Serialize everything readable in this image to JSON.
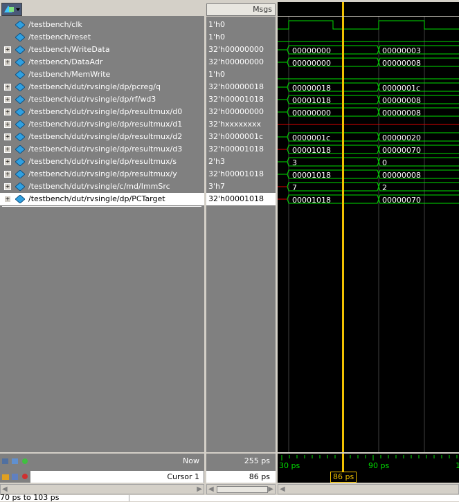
{
  "header": {
    "msgs_label": "Msgs"
  },
  "signals": [
    {
      "name": "/testbench/clk",
      "value": "1'h0",
      "expand": false
    },
    {
      "name": "/testbench/reset",
      "value": "1'h0",
      "expand": false
    },
    {
      "name": "/testbench/WriteData",
      "value": "32'h00000000",
      "expand": true
    },
    {
      "name": "/testbench/DataAdr",
      "value": "32'h00000000",
      "expand": true
    },
    {
      "name": "/testbench/MemWrite",
      "value": "1'h0",
      "expand": false
    },
    {
      "name": "/testbench/dut/rvsingle/dp/pcreg/q",
      "value": "32'h00000018",
      "expand": true
    },
    {
      "name": "/testbench/dut/rvsingle/dp/rf/wd3",
      "value": "32'h00001018",
      "expand": true
    },
    {
      "name": "/testbench/dut/rvsingle/dp/resultmux/d0",
      "value": "32'h00000000",
      "expand": true
    },
    {
      "name": "/testbench/dut/rvsingle/dp/resultmux/d1",
      "value": "32'hxxxxxxxx",
      "expand": true
    },
    {
      "name": "/testbench/dut/rvsingle/dp/resultmux/d2",
      "value": "32'h0000001c",
      "expand": true
    },
    {
      "name": "/testbench/dut/rvsingle/dp/resultmux/d3",
      "value": "32'h00001018",
      "expand": true
    },
    {
      "name": "/testbench/dut/rvsingle/dp/resultmux/s",
      "value": "2'h3",
      "expand": true
    },
    {
      "name": "/testbench/dut/rvsingle/dp/resultmux/y",
      "value": "32'h00001018",
      "expand": true
    },
    {
      "name": "/testbench/dut/rvsingle/c/md/ImmSrc",
      "value": "3'h7",
      "expand": true
    },
    {
      "name": "/testbench/dut/rvsingle/dp/PCTarget",
      "value": "32'h00001018",
      "expand": true
    }
  ],
  "wave_labels": [
    {
      "a": "",
      "b": ""
    },
    {
      "a": "",
      "b": ""
    },
    {
      "a": "00000000",
      "b": "00000003"
    },
    {
      "a": "00000000",
      "b": "00000008"
    },
    {
      "a": "",
      "b": ""
    },
    {
      "a": "00000018",
      "b": "0000001c"
    },
    {
      "a": "00001018",
      "b": "00000008"
    },
    {
      "a": "00000000",
      "b": "00000008"
    },
    {
      "a": "",
      "b": ""
    },
    {
      "a": "0000001c",
      "b": "00000020"
    },
    {
      "a": "00001018",
      "b": "00000070"
    },
    {
      "a": "3",
      "b": "0"
    },
    {
      "a": "00001018",
      "b": "00000008"
    },
    {
      "a": "7",
      "b": "2"
    },
    {
      "a": "00001018",
      "b": "00000070"
    }
  ],
  "footer": {
    "now_label": "Now",
    "now_value": "255 ps",
    "cursor_label": "Cursor 1",
    "cursor_value": "86 ps",
    "time_tick_1": "30 ps",
    "time_tick_2": "90 ps",
    "time_tick_3": "1",
    "cursor_marker": "86 ps",
    "status_text": "70 ps to 103 ps"
  },
  "colors": {
    "wave_green": "#00e000",
    "cursor_yellow": "#f0c000",
    "undef_red": "#e00000"
  }
}
